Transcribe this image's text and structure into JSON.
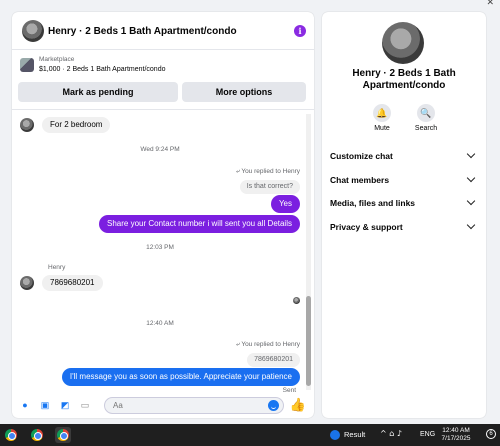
{
  "header": {
    "title": "Henry · 2 Beds 1 Bath Apartment/condo"
  },
  "listing": {
    "source": "Marketplace",
    "price_title": "$1,000 · 2 Beds 1 Bath Apartment/condo",
    "mark_pending_label": "Mark as pending",
    "more_options_label": "More options"
  },
  "messages": {
    "m1": "For 2 bedroom",
    "stamp1": "Wed 9:24 PM",
    "reply1_label": "You replied to Henry",
    "reply1_quoted": "Is that correct?",
    "m2": "Yes",
    "m3": "Share your Contact number i will sent you all Details",
    "stamp2": "12:03 PM",
    "sender_name": "Henry",
    "m4": "7869680201",
    "stamp3": "12:40 AM",
    "reply2_label": "You replied to Henry",
    "reply2_quoted": "7869680201",
    "m5": "I'll message you as soon as possible. Appreciate your patience",
    "status": "Sent"
  },
  "composer": {
    "placeholder": "Aa"
  },
  "sidebar": {
    "name": "Henry · 2 Beds 1 Bath Apartment/condo",
    "mute_label": "Mute",
    "search_label": "Search",
    "sections": [
      "Customize chat",
      "Chat members",
      "Media, files and links",
      "Privacy & support"
    ]
  },
  "taskbar": {
    "result_label": "Result",
    "lang": "ENG",
    "time": "12:40 AM",
    "date": "7/17/2025",
    "notifications": "6"
  },
  "colors": {
    "accent_purple": "#7b1fe0",
    "accent_blue": "#1a6ff0"
  }
}
